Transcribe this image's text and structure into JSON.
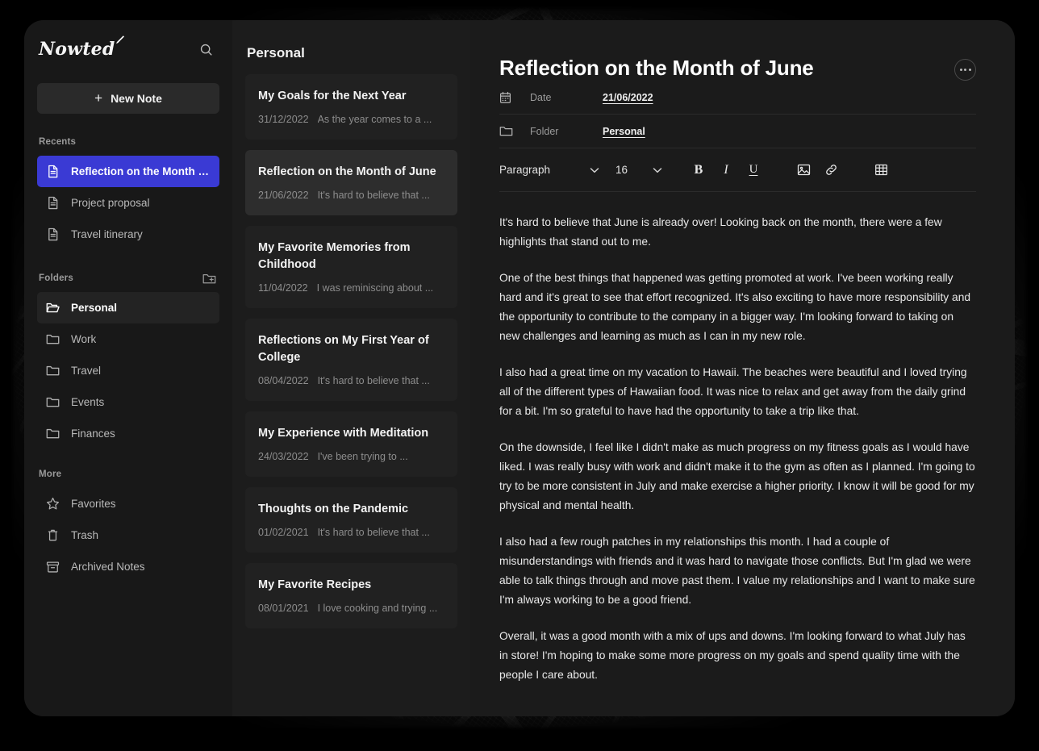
{
  "app": {
    "brand": "Nowted",
    "brand_icon": "pen-icon",
    "search_icon": "search-icon"
  },
  "sidebar": {
    "new_note_label": "New Note",
    "new_note_icon": "plus-icon",
    "sections": {
      "recents_label": "Recents",
      "folders_label": "Folders",
      "add_folder_icon": "folder-plus-icon",
      "more_label": "More"
    },
    "recents": [
      {
        "label": "Reflection on the Month of June",
        "icon": "document-icon",
        "active": true
      },
      {
        "label": "Project proposal",
        "icon": "document-icon",
        "active": false
      },
      {
        "label": "Travel itinerary",
        "icon": "document-icon",
        "active": false
      }
    ],
    "folders": [
      {
        "label": "Personal",
        "icon": "folder-open-icon",
        "active": true
      },
      {
        "label": "Work",
        "icon": "folder-icon",
        "active": false
      },
      {
        "label": "Travel",
        "icon": "folder-icon",
        "active": false
      },
      {
        "label": "Events",
        "icon": "folder-icon",
        "active": false
      },
      {
        "label": "Finances",
        "icon": "folder-icon",
        "active": false
      }
    ],
    "more": [
      {
        "label": "Favorites",
        "icon": "star-icon"
      },
      {
        "label": "Trash",
        "icon": "trash-icon"
      },
      {
        "label": "Archived Notes",
        "icon": "archive-icon"
      }
    ]
  },
  "notelist": {
    "title": "Personal",
    "notes": [
      {
        "title": "My Goals for the Next Year",
        "date": "31/12/2022",
        "snippet": "As the year comes to a ...",
        "selected": false
      },
      {
        "title": "Reflection on the Month of June",
        "date": "21/06/2022",
        "snippet": "It's hard to believe that ...",
        "selected": true
      },
      {
        "title": "My Favorite Memories from Childhood",
        "date": "11/04/2022",
        "snippet": "I was reminiscing about ...",
        "selected": false
      },
      {
        "title": "Reflections on My First Year of College",
        "date": "08/04/2022",
        "snippet": "It's hard to believe that ...",
        "selected": false
      },
      {
        "title": "My Experience with Meditation",
        "date": "24/03/2022",
        "snippet": "I've been trying to ...",
        "selected": false
      },
      {
        "title": "Thoughts on the Pandemic",
        "date": "01/02/2021",
        "snippet": "It's hard to believe that ...",
        "selected": false
      },
      {
        "title": "My Favorite Recipes",
        "date": "08/01/2021",
        "snippet": "I love cooking and trying ...",
        "selected": false
      }
    ]
  },
  "editor": {
    "title": "Reflection on the Month of June",
    "more_icon": "ellipsis-icon",
    "meta": {
      "date_label": "Date",
      "date_value": "21/06/2022",
      "date_icon": "calendar-icon",
      "folder_label": "Folder",
      "folder_value": "Personal",
      "folder_icon": "folder-icon"
    },
    "toolbar": {
      "block_style": "Paragraph",
      "font_size": "16",
      "bold_label": "B",
      "italic_label": "I",
      "underline_label": "U",
      "image_icon": "image-icon",
      "link_icon": "link-icon",
      "table_icon": "table-icon",
      "chevron_icon": "chevron-down-icon"
    },
    "paragraphs": [
      "It's hard to believe that June is already over! Looking back on the month, there were a few highlights that stand out to me.",
      "One of the best things that happened was getting promoted at work. I've been working really hard and it's great to see that effort recognized. It's also exciting to have more responsibility and the opportunity to contribute to the company in a bigger way. I'm looking forward to taking on new challenges and learning as much as I can in my new role.",
      "I also had a great time on my vacation to Hawaii. The beaches were beautiful and I loved trying all of the different types of Hawaiian food. It was nice to relax and get away from the daily grind for a bit. I'm so grateful to have had the opportunity to take a trip like that.",
      "On the downside, I feel like I didn't make as much progress on my fitness goals as I would have liked. I was really busy with work and didn't make it to the gym as often as I planned. I'm going to try to be more consistent in July and make exercise a higher priority. I know it will be good for my physical and mental health.",
      "I also had a few rough patches in my relationships this month. I had a couple of misunderstandings with friends and it was hard to navigate those conflicts. But I'm glad we were able to talk things through and move past them. I value my relationships and I want to make sure I'm always working to be a good friend.",
      "Overall, it was a good month with a mix of ups and downs. I'm looking forward to what July has in store! I'm hoping to make some more progress on my goals and spend quality time with the people I care about."
    ]
  },
  "colors": {
    "accent": "#3a3ad4",
    "window_bg": "#181818",
    "notelist_bg": "#1c1c1c",
    "editor_bg": "#1b1b1b",
    "card_bg": "#212121",
    "card_selected_bg": "#2d2d2d"
  }
}
